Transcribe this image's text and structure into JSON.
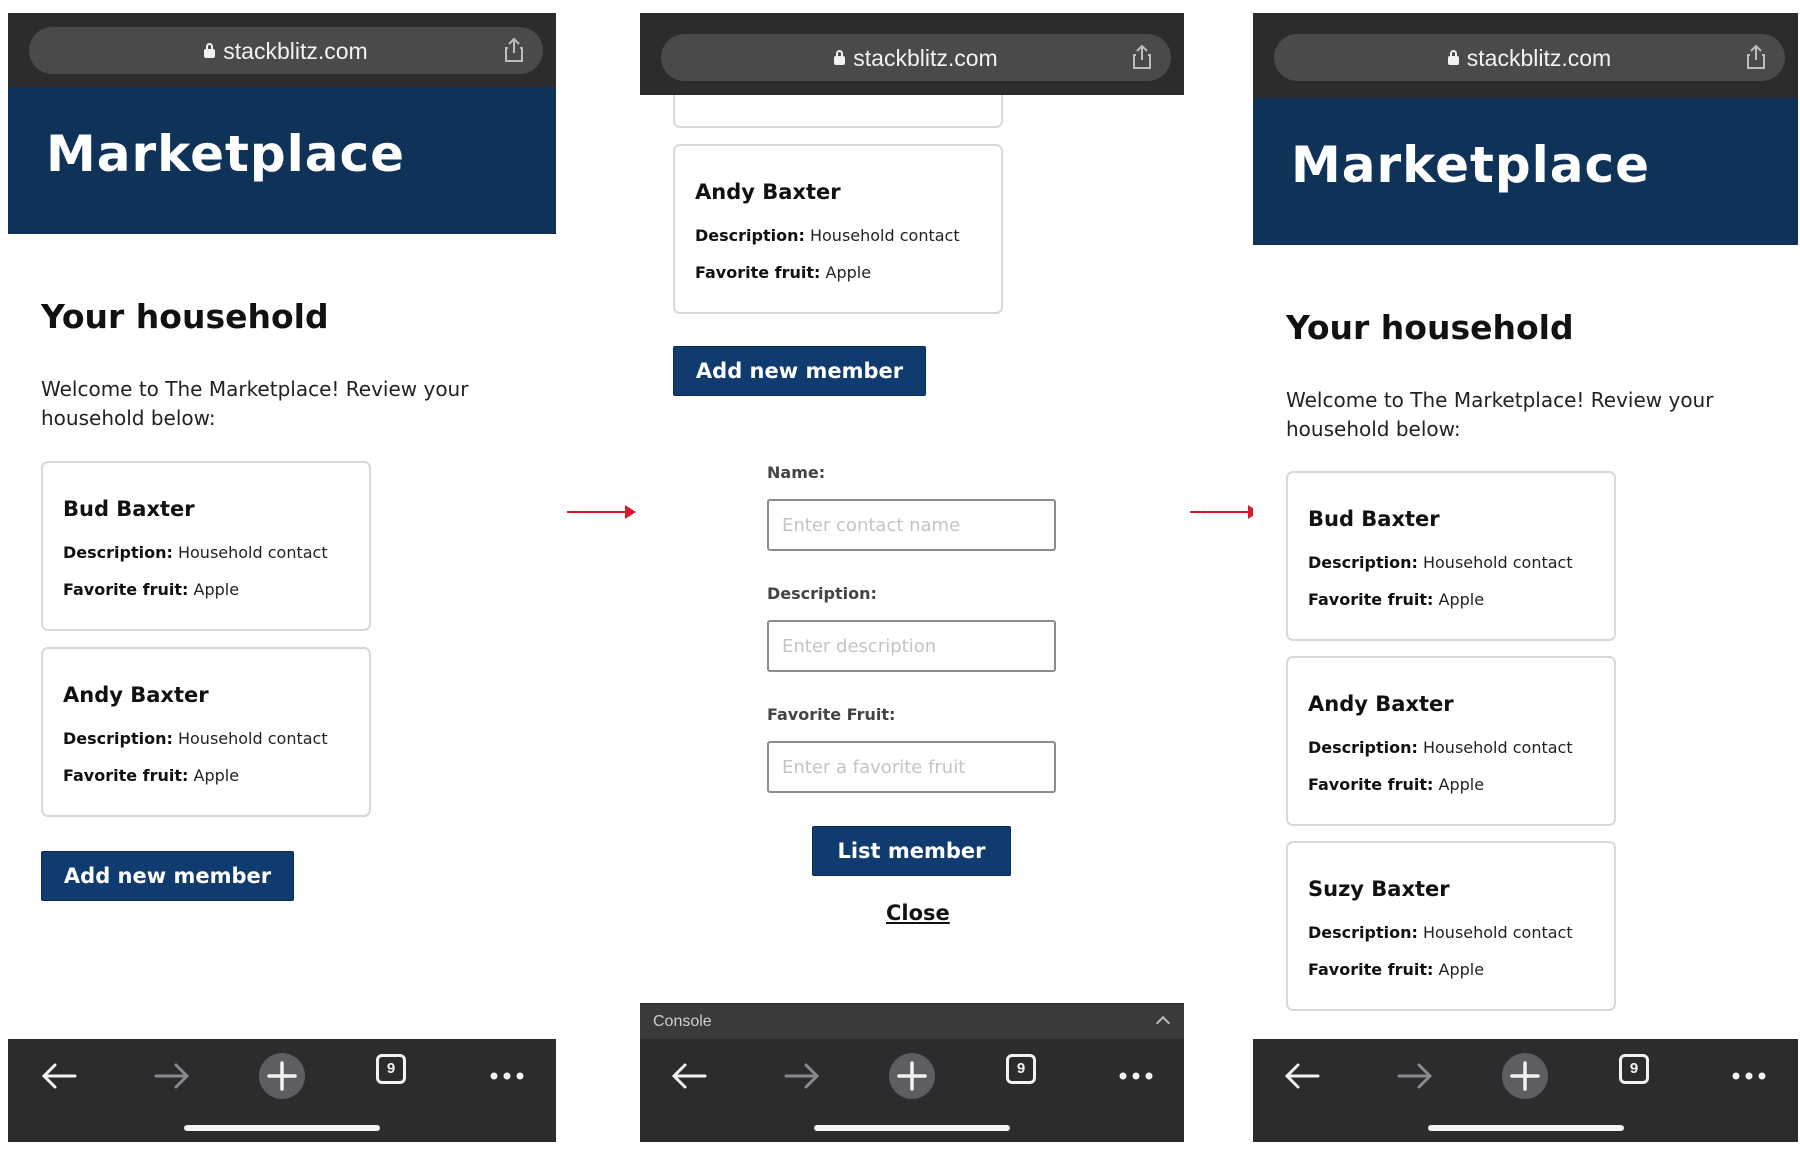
{
  "browser": {
    "url": "stackblitz.com",
    "tab_count": "9"
  },
  "app": {
    "title": "Marketplace"
  },
  "household": {
    "heading": "Your household",
    "welcome": "Welcome to The Marketplace! Review your household below:",
    "description_label": "Description:",
    "fruit_label": "Favorite fruit:",
    "members_before": [
      {
        "name": "Bud Baxter",
        "description": "Household contact",
        "fruit": "Apple"
      },
      {
        "name": "Andy Baxter",
        "description": "Household contact",
        "fruit": "Apple"
      }
    ],
    "members_after": [
      {
        "name": "Bud Baxter",
        "description": "Household contact",
        "fruit": "Apple"
      },
      {
        "name": "Andy Baxter",
        "description": "Household contact",
        "fruit": "Apple"
      },
      {
        "name": "Suzy Baxter",
        "description": "Household contact",
        "fruit": "Apple"
      }
    ],
    "add_button": "Add new member"
  },
  "form": {
    "name_label": "Name:",
    "name_placeholder": "Enter contact name",
    "description_label": "Description:",
    "description_placeholder": "Enter description",
    "fruit_label": "Favorite Fruit:",
    "fruit_placeholder": "Enter a favorite fruit",
    "submit_button": "List member",
    "close_link": "Close"
  },
  "console": {
    "label": "Console"
  },
  "colors": {
    "brand": "#0f3258",
    "button": "#0f3b6e",
    "arrow": "#d7192a",
    "chrome": "#2c2c2e"
  },
  "icons": [
    "lock-icon",
    "share-icon",
    "back-arrow-icon",
    "forward-arrow-icon",
    "new-tab-plus-icon",
    "tabs-count-icon",
    "more-menu-icon",
    "chevron-up-icon"
  ]
}
